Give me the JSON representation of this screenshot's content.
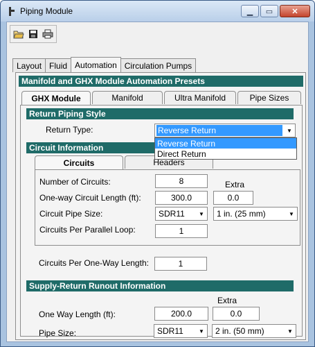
{
  "window": {
    "title": "Piping Module",
    "icon": "piping-module-icon"
  },
  "toolbar": {
    "icons": [
      "open-folder-icon",
      "save-icon",
      "print-icon"
    ]
  },
  "main_tabs": [
    "Layout",
    "Fluid",
    "Automation",
    "Circulation Pumps"
  ],
  "panel_title": "Manifold and GHX Module Automation Presets",
  "sub_tabs": [
    "GHX Module",
    "Manifold",
    "Ultra Manifold",
    "Pipe Sizes"
  ],
  "return_piping": {
    "title": "Return Piping Style",
    "return_type_label": "Return Type:",
    "return_type_value": "Reverse Return",
    "options": [
      "Reverse Return",
      "Direct Return"
    ]
  },
  "circuit_info": {
    "title": "Circuit Information",
    "tabs": [
      "Circuits",
      "Headers"
    ],
    "extra_label": "Extra",
    "rows": {
      "num_circuits_label": "Number of Circuits:",
      "num_circuits_value": "8",
      "length_label": "One-way Circuit Length (ft):",
      "length_value": "300.0",
      "length_extra": "0.0",
      "pipe_size_label": "Circuit Pipe Size:",
      "pipe_sdr": "SDR11",
      "pipe_size": "1 in. (25 mm)",
      "per_parallel_label": "Circuits Per Parallel Loop:",
      "per_parallel_value": "1",
      "per_oneway_label": "Circuits Per One-Way Length:",
      "per_oneway_value": "1"
    }
  },
  "runout": {
    "title": "Supply-Return Runout Information",
    "extra_label": "Extra",
    "length_label": "One Way Length (ft):",
    "length_value": "200.0",
    "length_extra": "0.0",
    "pipe_size_label": "Pipe Size:",
    "pipe_sdr": "SDR11",
    "pipe_size": "2 in. (50 mm)"
  }
}
